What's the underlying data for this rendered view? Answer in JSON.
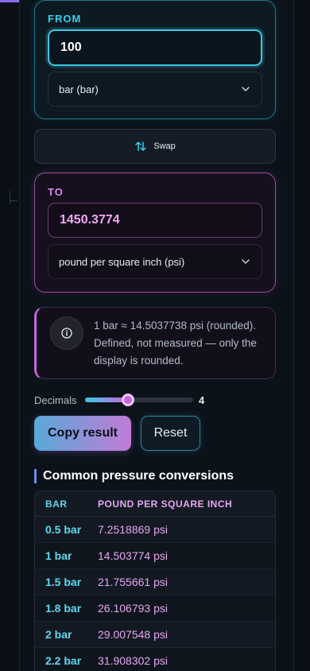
{
  "from": {
    "label": "FROM",
    "value": "100",
    "unit": "bar (bar)"
  },
  "swap": {
    "label": "Swap"
  },
  "to": {
    "label": "TO",
    "value": "1450.3774",
    "unit": "pound per square inch (psi)"
  },
  "info": {
    "text": "1 bar ≈ 14.5037738 psi (rounded). Defined, not measured — only the display is rounded."
  },
  "decimals": {
    "label": "Decimals",
    "value": "4",
    "fraction": 0.4
  },
  "actions": {
    "copy_label": "Copy result",
    "reset_label": "Reset"
  },
  "conversions": {
    "title": "Common pressure conversions",
    "columns": [
      "BAR",
      "POUND PER SQUARE INCH"
    ],
    "rows": [
      [
        "0.5 bar",
        "7.2518869 psi"
      ],
      [
        "1 bar",
        "14.503774 psi"
      ],
      [
        "1.5 bar",
        "21.755661 psi"
      ],
      [
        "1.8 bar",
        "26.106793 psi"
      ],
      [
        "2 bar",
        "29.007548 psi"
      ],
      [
        "2.2 bar",
        "31.908302 psi"
      ]
    ]
  },
  "colors": {
    "from_accent": "#34d3ee",
    "to_accent": "#e085ee",
    "background": "#0b1017"
  },
  "icons": {
    "swap": "swap-vertical-arrows-icon",
    "select": "chevron-down-icon",
    "info": "info-circle-icon"
  }
}
